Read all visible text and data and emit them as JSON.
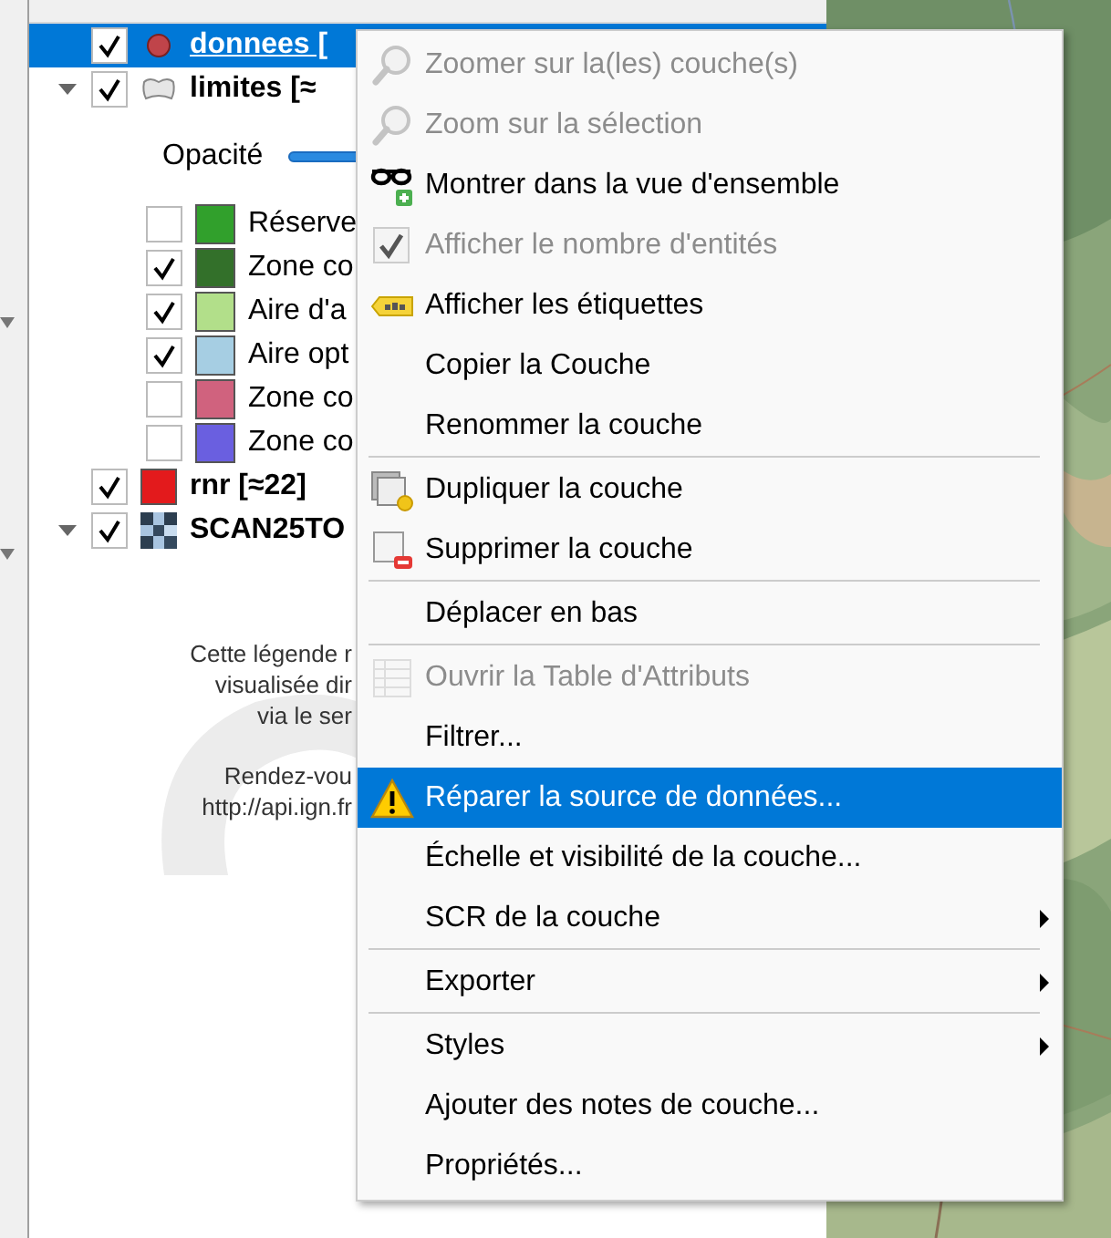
{
  "layers": [
    {
      "kind": "point",
      "name": "donnees [",
      "checked": true,
      "selected": true,
      "color": "#c0444a"
    },
    {
      "kind": "polygon",
      "name": "limites [≈",
      "checked": true,
      "selected": false,
      "expanded": true,
      "children": [
        {
          "kind": "opacity",
          "label": "Opacité",
          "level": 1
        },
        {
          "kind": "class",
          "label": "Réserve",
          "checked": false,
          "color": "#31a02c"
        },
        {
          "kind": "class",
          "label": "Zone co",
          "checked": true,
          "color": "#33702a"
        },
        {
          "kind": "class",
          "label": "Aire d'a",
          "checked": true,
          "color": "#b2df8a"
        },
        {
          "kind": "class",
          "label": "Aire opt",
          "checked": true,
          "color": "#a6cee3"
        },
        {
          "kind": "class",
          "label": "Zone co",
          "checked": false,
          "color": "#d0627e"
        },
        {
          "kind": "class",
          "label": "Zone co",
          "checked": false,
          "color": "#6a5fe0"
        }
      ]
    },
    {
      "kind": "fill",
      "name": "rnr [≈22]",
      "checked": true,
      "selected": false,
      "color": "#e31a1c"
    },
    {
      "kind": "raster",
      "name": "SCAN25TO",
      "checked": true,
      "selected": false,
      "expanded": true,
      "children": [
        {
          "kind": "legend_image",
          "paragraphs": [
            [
              "Cette légende r",
              "visualisée dir",
              "via le ser"
            ],
            [
              "Rendez-vou",
              "http://api.ign.fr"
            ]
          ]
        }
      ]
    }
  ],
  "menu": {
    "items": [
      {
        "kind": "zoom",
        "label": "Zoomer sur la(les) couche(s)",
        "disabled": true,
        "selected": false
      },
      {
        "kind": "zoom",
        "label": "Zoom sur la sélection",
        "disabled": true,
        "selected": false
      },
      {
        "kind": "overview",
        "label": "Montrer dans la vue d'ensemble",
        "disabled": false,
        "selected": false
      },
      {
        "kind": "toggle",
        "label": "Afficher le nombre d'entités",
        "disabled": true,
        "selected": false,
        "checked": true
      },
      {
        "kind": "labels",
        "label": "Afficher les étiquettes",
        "disabled": false,
        "selected": false
      },
      {
        "kind": "plain",
        "label": "Copier la Couche",
        "disabled": false,
        "selected": false
      },
      {
        "kind": "plain",
        "label": "Renommer la couche",
        "disabled": false,
        "selected": false
      },
      {
        "kind": "separator"
      },
      {
        "kind": "duplicate",
        "label": "Dupliquer la couche",
        "disabled": false,
        "selected": false
      },
      {
        "kind": "remove",
        "label": "Supprimer la couche",
        "disabled": false,
        "selected": false
      },
      {
        "kind": "separator"
      },
      {
        "kind": "plain",
        "label": "Déplacer en bas",
        "disabled": false,
        "selected": false
      },
      {
        "kind": "separator"
      },
      {
        "kind": "table",
        "label": "Ouvrir la Table d'Attributs",
        "disabled": true,
        "selected": false
      },
      {
        "kind": "plain",
        "label": "Filtrer...",
        "disabled": false,
        "selected": false
      },
      {
        "kind": "warning",
        "label": "Réparer la source de données...",
        "disabled": false,
        "selected": true
      },
      {
        "kind": "plain",
        "label": "Échelle et visibilité de la couche...",
        "disabled": false,
        "selected": false
      },
      {
        "kind": "plain",
        "label": "SCR de la couche",
        "disabled": false,
        "selected": false,
        "submenu": true
      },
      {
        "kind": "separator"
      },
      {
        "kind": "plain",
        "label": "Exporter",
        "disabled": false,
        "selected": false,
        "submenu": true
      },
      {
        "kind": "separator"
      },
      {
        "kind": "plain",
        "label": "Styles",
        "disabled": false,
        "selected": false,
        "submenu": true
      },
      {
        "kind": "plain",
        "label": "Ajouter des notes de couche...",
        "disabled": false,
        "selected": false
      },
      {
        "kind": "plain",
        "label": "Propriétés...",
        "disabled": false,
        "selected": false
      }
    ]
  }
}
